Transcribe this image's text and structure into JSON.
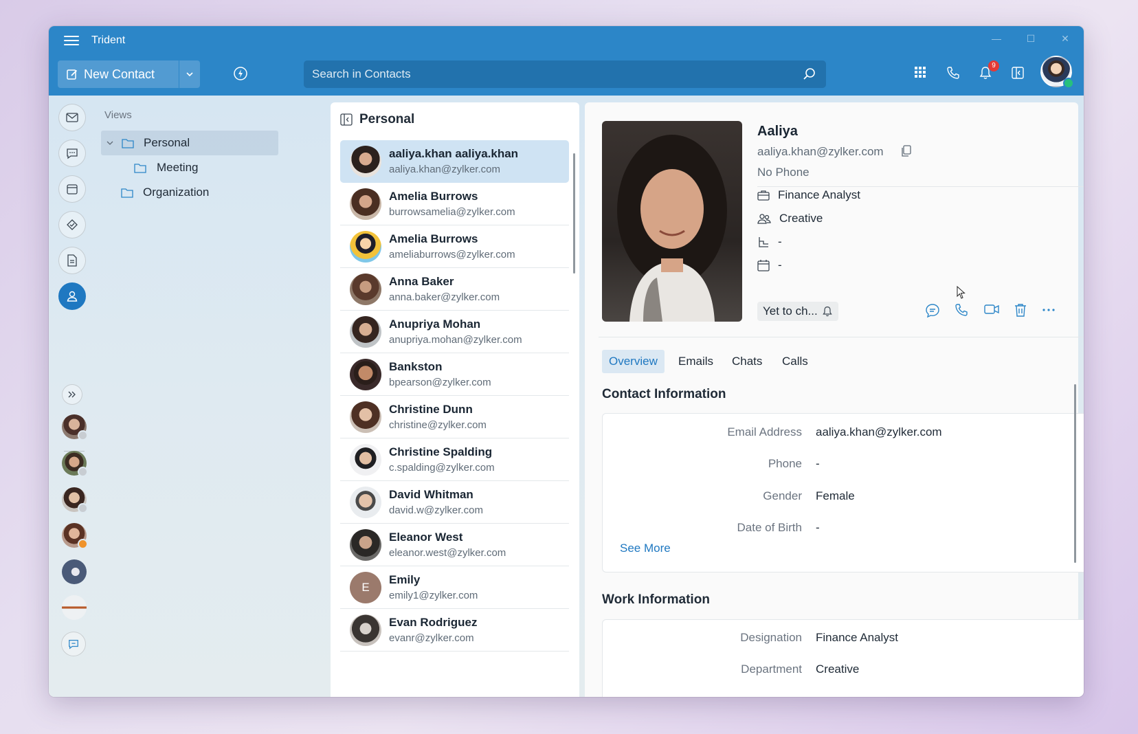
{
  "app": {
    "title": "Trident"
  },
  "toolbar": {
    "new_contact": "New Contact",
    "search_placeholder": "Search in Contacts",
    "notifications_count": "9"
  },
  "views": {
    "title": "Views",
    "items": [
      {
        "label": "Personal"
      },
      {
        "label": "Meeting"
      },
      {
        "label": "Organization"
      }
    ]
  },
  "list": {
    "title": "Personal",
    "contacts": [
      {
        "name": "aaliya.khan aaliya.khan",
        "email": "aaliya.khan@zylker.com"
      },
      {
        "name": "Amelia Burrows",
        "email": "burrowsamelia@zylker.com"
      },
      {
        "name": "Amelia Burrows",
        "email": "ameliaburrows@zylker.com"
      },
      {
        "name": "Anna Baker",
        "email": "anna.baker@zylker.com"
      },
      {
        "name": "Anupriya Mohan",
        "email": "anupriya.mohan@zylker.com"
      },
      {
        "name": "Bankston",
        "email": "bpearson@zylker.com"
      },
      {
        "name": "Christine Dunn",
        "email": "christine@zylker.com"
      },
      {
        "name": "Christine Spalding",
        "email": "c.spalding@zylker.com"
      },
      {
        "name": "David Whitman",
        "email": "david.w@zylker.com"
      },
      {
        "name": "Eleanor West",
        "email": "eleanor.west@zylker.com"
      },
      {
        "name": "Emily",
        "email": "emily1@zylker.com",
        "initial": "E"
      },
      {
        "name": "Evan Rodriguez",
        "email": "evanr@zylker.com"
      }
    ]
  },
  "detail": {
    "name": "Aaliya",
    "email": "aaliya.khan@zylker.com",
    "phone": "No Phone",
    "designation": "Finance Analyst",
    "department": "Creative",
    "reports_to": "-",
    "joining": "-",
    "status_chip": "Yet to ch...",
    "tabs": [
      "Overview",
      "Emails",
      "Chats",
      "Calls"
    ],
    "contact_info_title": "Contact Information",
    "contact_info": [
      {
        "key": "Email Address",
        "value": "aaliya.khan@zylker.com"
      },
      {
        "key": "Phone",
        "value": "-"
      },
      {
        "key": "Gender",
        "value": "Female"
      },
      {
        "key": "Date of Birth",
        "value": "-"
      }
    ],
    "see_more": "See More",
    "work_info_title": "Work Information",
    "work_info": [
      {
        "key": "Designation",
        "value": "Finance Analyst"
      },
      {
        "key": "Department",
        "value": "Creative"
      }
    ]
  }
}
